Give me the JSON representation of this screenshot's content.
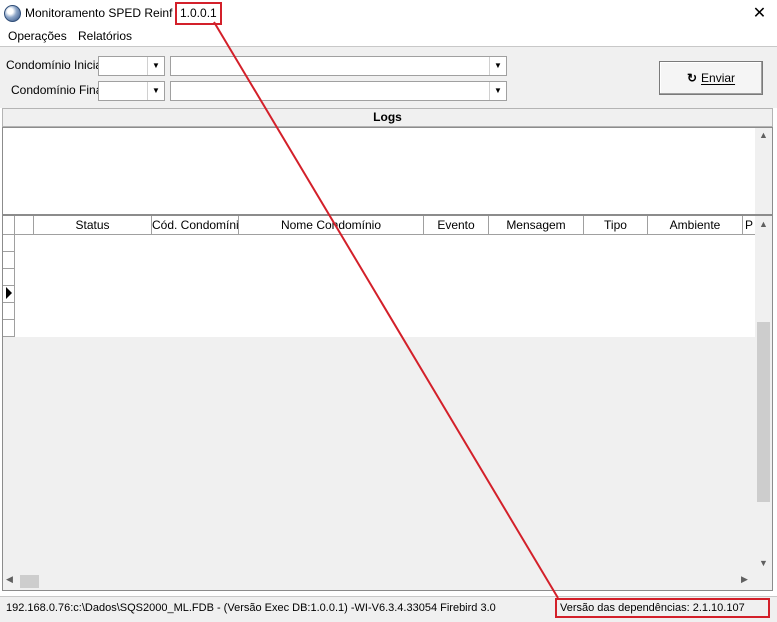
{
  "window": {
    "title": "Monitoramento SPED Reinf -",
    "version": "1.0.0.1",
    "close_glyph": "✕"
  },
  "menu": {
    "items": [
      "Operações",
      "Relatórios"
    ]
  },
  "filters": {
    "initial_label": "Condomínio Inicial",
    "final_label": "Condomínio Final",
    "initial_code": "",
    "initial_name": "",
    "final_code": "",
    "final_name": ""
  },
  "send_button": {
    "label": "Enviar",
    "icon": "refresh-icon",
    "glyph": "↻"
  },
  "logs": {
    "header": "Logs",
    "content": ""
  },
  "grid": {
    "columns": [
      "",
      "",
      "Status",
      "Cód. Condomínio",
      "Nome Condomínio",
      "Evento",
      "Mensagem",
      "Tipo",
      "Ambiente",
      "P"
    ],
    "rows": []
  },
  "status_bar": {
    "connection": "192.168.0.76:c:\\Dados\\SQS2000_ML.FDB - (Versão Exec DB:1.0.0.1) -WI-V6.3.4.33054 Firebird 3.0",
    "dependencies": "Versão das dependências: 2.1.10.107"
  },
  "colors": {
    "highlight": "#d3202a",
    "panel": "#f0f0f0"
  }
}
